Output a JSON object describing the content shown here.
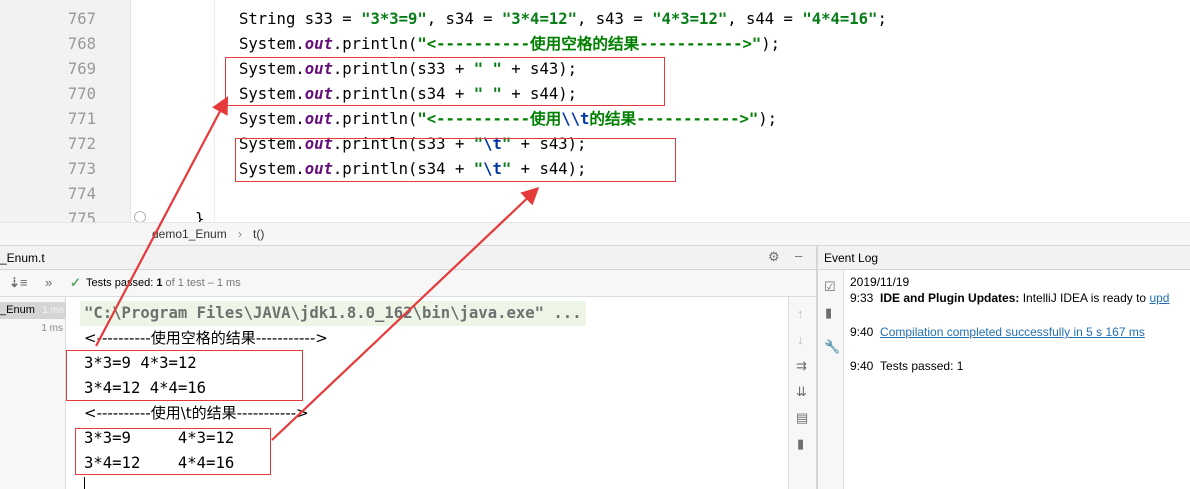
{
  "editor": {
    "line_numbers": [
      "767",
      "768",
      "769",
      "770",
      "771",
      "772",
      "773",
      "774",
      "775"
    ],
    "lines": [
      {
        "pre": "String s33 = ",
        "s1": "\"3*3=9\"",
        "m1": ", s34 = ",
        "s2": "\"3*4=12\"",
        "m2": ", s43 = ",
        "s3": "\"4*3=12\"",
        "m3": ", s44 = ",
        "s4": "\"4*4=16\"",
        "end": ";"
      },
      {
        "pre": "System.",
        "out": "out",
        "mid": ".println(",
        "str": "\"<----------使用空格的结果----------->\"",
        "end": ");"
      },
      {
        "pre": "System.",
        "out": "out",
        "mid": ".println(s33 + ",
        "str": "\" \"",
        "end": " + s43);"
      },
      {
        "pre": "System.",
        "out": "out",
        "mid": ".println(s34 + ",
        "str": "\" \"",
        "end": " + s44);"
      },
      {
        "pre": "System.",
        "out": "out",
        "mid": ".println(",
        "str_a": "\"<----------使用",
        "esc": "\\\\t",
        "str_b": "的结果----------->\"",
        "end": ");"
      },
      {
        "pre": "System.",
        "out": "out",
        "mid": ".println(s33 + ",
        "q1": "\"",
        "esc": "\\t",
        "q2": "\"",
        "end": " + s43);"
      },
      {
        "pre": "System.",
        "out": "out",
        "mid": ".println(s34 + ",
        "q1": "\"",
        "esc": "\\t",
        "q2": "\"",
        "end": " + s44);"
      }
    ],
    "closing_brace": "}"
  },
  "breadcrumb": {
    "class": "demo1_Enum",
    "sep": "›",
    "method": "t()"
  },
  "run": {
    "tab_label": "_Enum.t",
    "tree_item": "_Enum",
    "tree_time": "1 ms",
    "tree_time2": "1 ms",
    "status_bold": "Tests passed: ",
    "status_count": "1",
    "status_rest": " of 1 test – 1 ms",
    "console": [
      "\"C:\\Program Files\\JAVA\\jdk1.8.0_162\\bin\\java.exe\" ...",
      "<----------使用空格的结果----------->",
      "3*3=9 4*3=12",
      "3*4=12 4*4=16",
      "<----------使用\\t的结果----------->",
      "3*3=9\t4*3=12",
      "3*4=12\t4*4=16"
    ]
  },
  "event_log": {
    "title": "Event Log",
    "date": "2019/11/19",
    "entries": [
      {
        "time": "9:33",
        "bold": "IDE and Plugin Updates:",
        "text": " IntelliJ IDEA is ready to ",
        "link": "upd"
      },
      {
        "time": "9:40",
        "link": "Compilation completed successfully in 5 s 167 ms"
      },
      {
        "time": "9:40",
        "text": "Tests passed: 1"
      }
    ]
  },
  "colors": {
    "annotation": "#e5393a",
    "string": "#067d17",
    "field": "#660e7a",
    "escape": "#0037a6",
    "link": "#2470b3"
  },
  "icons": [
    "gear-icon",
    "minimize-icon",
    "sort-icon",
    "check-icon",
    "up-arrow-icon",
    "down-arrow-icon",
    "soft-wrap-icon",
    "scroll-to-end-icon",
    "print-icon",
    "trash-icon",
    "wrench-icon"
  ]
}
